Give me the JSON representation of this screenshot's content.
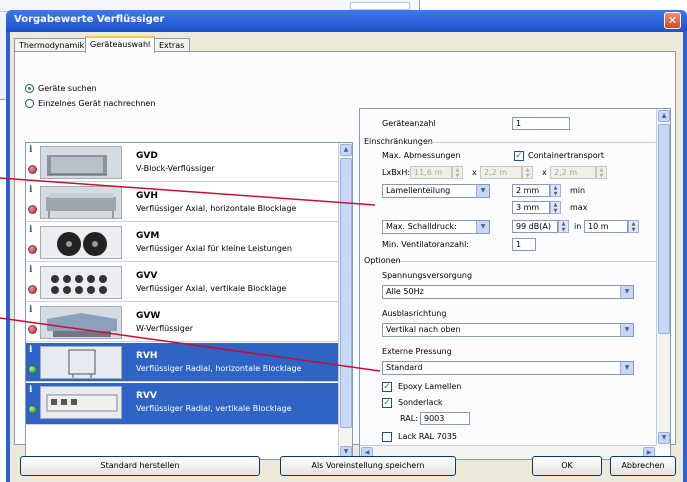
{
  "window": {
    "title": "Vorgabewerte Verflüssiger",
    "close_glyph": "✕"
  },
  "tabs": [
    {
      "label": "Thermodynamik",
      "active": false
    },
    {
      "label": "Geräteauswahl",
      "active": true
    },
    {
      "label": "Extras",
      "active": false
    }
  ],
  "mode": {
    "options": [
      {
        "label": "Geräte suchen",
        "selected": true
      },
      {
        "label": "Einzelnes Gerät nachrechnen",
        "selected": false
      }
    ]
  },
  "devices": [
    {
      "info": "i",
      "name": "GVD",
      "desc": "V-Block-Verflüssiger",
      "status": "red",
      "selected": false,
      "icon": "block-condenser-image"
    },
    {
      "info": "i",
      "name": "GVH",
      "desc": "Verflüssiger Axial, horizontale Blocklage",
      "status": "red",
      "selected": false,
      "icon": "horizontal-condenser-image"
    },
    {
      "info": "i",
      "name": "GVM",
      "desc": "Verflüssiger Axial für kleine Leistungen",
      "status": "red",
      "selected": false,
      "icon": "fan-condenser-image"
    },
    {
      "info": "i",
      "name": "GVV",
      "desc": "Verflüssiger Axial, vertikale Blocklage",
      "status": "red",
      "selected": false,
      "icon": "vertical-fan-condenser-image"
    },
    {
      "info": "i",
      "name": "GVW",
      "desc": "W-Verflüssiger",
      "status": "red",
      "selected": false,
      "icon": "w-condenser-image"
    },
    {
      "info": "i",
      "name": "RVH",
      "desc": "Verflüssiger Radial, horizontale Blocklage",
      "status": "green",
      "selected": true,
      "icon": "radial-horizontal-condenser-image"
    },
    {
      "info": "i",
      "name": "RVV",
      "desc": "Verflüssiger Radial, vertikale Blocklage",
      "status": "green",
      "selected": true,
      "icon": "radial-vertical-condenser-image"
    }
  ],
  "options": {
    "count_label": "Geräteanzahl",
    "count_value": "1",
    "restrictions_label": "Einschränkungen",
    "max_dims_label": "Max. Abmessungen",
    "container_label": "Containertransport",
    "container_checked": true,
    "lxbxh_label": "LxBxH:",
    "dim_l": "11,6 m",
    "dim_b": "2,2 m",
    "dim_h": "2,2 m",
    "times1": "x",
    "times2": "x",
    "lamellae_label": "Lamellenteilung",
    "lamellae_min": "2 mm",
    "min_label": "min",
    "lamellae_max": "3 mm",
    "max_label": "max",
    "noise_label": "Max. Schalldruck:",
    "noise_value": "99 dB(A)",
    "in_label": "in",
    "noise_distance": "10 m",
    "min_fans_label": "Min. Ventilatoranzahl:",
    "min_fans_value": "1",
    "options_label": "Optionen",
    "supply_label": "Spannungsversorgung",
    "supply_value": "Alle 50Hz",
    "outlet_label": "Ausblasrichtung",
    "outlet_value": "Vertikal nach oben",
    "pressure_label": "Externe Pressung",
    "pressure_value": "Standard",
    "epoxy_label": "Epoxy Lamellen",
    "epoxy_checked": true,
    "special_label": "Sonderlack",
    "special_checked": true,
    "ral_label": "RAL:",
    "ral_value": "9003",
    "lack_label": "Lack RAL 7035"
  },
  "buttons": {
    "standard": "Standard herstellen",
    "save_default": "Als Voreinstellung speichern",
    "ok": "OK",
    "cancel": "Abbrechen"
  },
  "colors": {
    "title_bar": "#2a5fd8",
    "selection": "#2f63c6",
    "callout": "#c8102e"
  }
}
